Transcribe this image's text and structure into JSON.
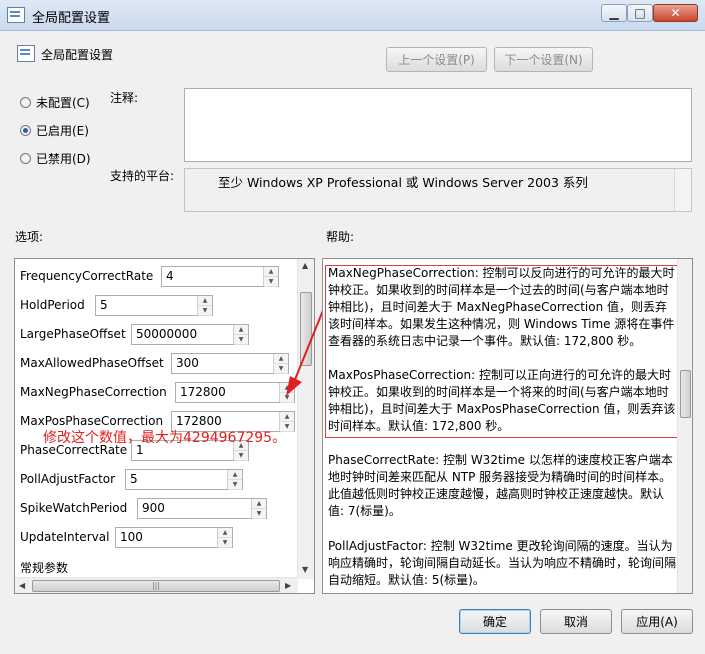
{
  "window": {
    "title": "全局配置设置",
    "controls": {
      "minimize": "▁",
      "maximize": "□",
      "close": "✕"
    }
  },
  "header": {
    "title": "全局配置设置",
    "prev_button": "上一个设置(P)",
    "next_button": "下一个设置(N)"
  },
  "state": {
    "options": [
      {
        "label": "未配置(C)",
        "checked": false
      },
      {
        "label": "已启用(E)",
        "checked": true
      },
      {
        "label": "已禁用(D)",
        "checked": false
      }
    ]
  },
  "comment": {
    "label": "注释:",
    "value": ""
  },
  "platform": {
    "label": "支持的平台:",
    "value": "至少 Windows XP Professional 或 Windows Server 2003 系列"
  },
  "sections": {
    "options_label": "选项:",
    "help_label": "帮助:"
  },
  "options": [
    {
      "name": "FrequencyCorrectRate",
      "value": "4"
    },
    {
      "name": "HoldPeriod",
      "value": "5"
    },
    {
      "name": "LargePhaseOffset",
      "value": "50000000"
    },
    {
      "name": "MaxAllowedPhaseOffset",
      "value": "300"
    },
    {
      "name": "MaxNegPhaseCorrection",
      "value": "172800"
    },
    {
      "name": "MaxPosPhaseCorrection",
      "value": "172800"
    },
    {
      "name": "PhaseCorrectRate",
      "value": "1"
    },
    {
      "name": "PollAdjustFactor",
      "value": "5"
    },
    {
      "name": "SpikeWatchPeriod",
      "value": "900"
    },
    {
      "name": "UpdateInterval",
      "value": "100"
    }
  ],
  "options_footer": "常规参数",
  "annotation": "修改这个数值，最大为4294967295。",
  "help": [
    "MaxNegPhaseCorrection: 控制可以反向进行的可允许的最大时钟校正。如果收到的时间样本是一个过去的时间(与客户端本地时钟相比)，且时间差大于 MaxNegPhaseCorrection 值，则丢弃该时间样本。如果发生这种情况，则 Windows Time 源将在事件查看器的系统日志中记录一个事件。默认值: 172,800 秒。",
    "MaxPosPhaseCorrection: 控制可以正向进行的可允许的最大时钟校正。如果收到的时间样本是一个将来的时间(与客户端本地时钟相比)，且时间差大于 MaxPosPhaseCorrection 值，则丢弃该时间样本。默认值: 172,800 秒。",
    "PhaseCorrectRate: 控制 W32time 以怎样的速度校正客户端本地时钟时间差来匹配从 NTP 服务器接受为精确时间的时间样本。此值越低则时钟校正速度越慢，越高则时钟校正速度越快。默认值: 7(标量)。",
    "PollAdjustFactor: 控制 W32time 更改轮询间隔的速度。当认为响应精确时，轮询间隔自动延长。当认为响应不精确时，轮询间隔自动缩短。默认值: 5(标量)。"
  ],
  "footer": {
    "ok": "确定",
    "cancel": "取消",
    "apply": "应用(A)"
  },
  "colors": {
    "annotation": "#e02020",
    "highlight_border": "#e23c3c"
  }
}
